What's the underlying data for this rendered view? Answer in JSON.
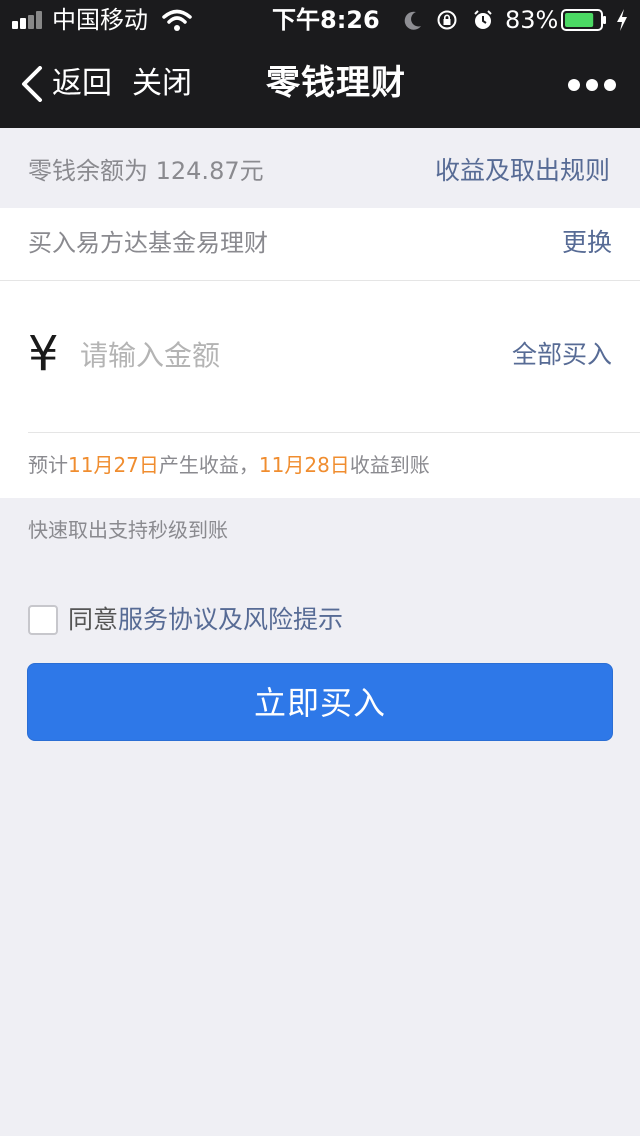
{
  "status_bar": {
    "carrier": "中国移动",
    "time": "下午8:26",
    "battery_percent": "83%",
    "battery_level": 0.83,
    "battery_color": "#4cd964",
    "icons": [
      "signal-icon",
      "wifi-icon",
      "moon-icon",
      "rotation-lock-icon",
      "alarm-icon",
      "battery-icon",
      "charging-icon"
    ]
  },
  "nav": {
    "back_label": "返回",
    "close_label": "关闭",
    "title": "零钱理财",
    "more_icon": "more-icon"
  },
  "balance": {
    "text": "零钱余额为 124.87元",
    "rules_link": "收益及取出规则"
  },
  "fund": {
    "label": "买入易方达基金易理财",
    "change_link": "更换"
  },
  "amount": {
    "currency_symbol": "¥",
    "placeholder": "请输入金额",
    "value": "",
    "buy_all_link": "全部买入"
  },
  "estimate": {
    "prefix": "预计",
    "start_date": "11月27日",
    "middle": "产生收益，",
    "arrival_date": "11月28日",
    "suffix": "收益到账"
  },
  "tip": "快速取出支持秒级到账",
  "agreement": {
    "checked": false,
    "prefix": "同意",
    "link": "服务协议及风险提示"
  },
  "buy_button": {
    "label": "立即买入",
    "color": "#2e78e8"
  },
  "colors": {
    "nav_background": "#1b1b1d",
    "link": "#576b95",
    "highlight_date": "#f08d2f",
    "page_background": "#efeff4"
  }
}
